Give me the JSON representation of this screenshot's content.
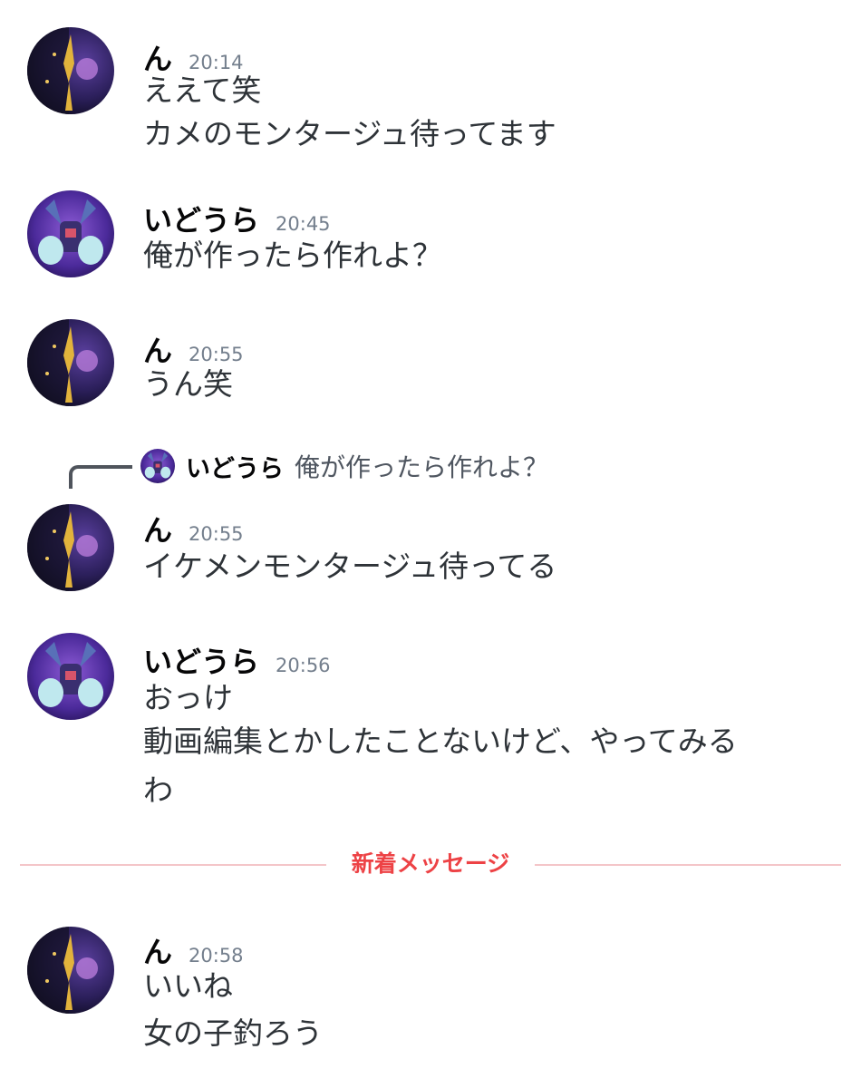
{
  "colors": {
    "text": "#2e3338",
    "author": "#060607",
    "timestamp": "#747f8d",
    "new_divider": "#ed4245",
    "reply_line": "#4f545c"
  },
  "users": {
    "n": {
      "name": "ん",
      "avatar_icon": "moon-split-avatar-icon"
    },
    "idoura": {
      "name": "いどうら",
      "avatar_icon": "purple-creature-avatar-icon"
    }
  },
  "messages": [
    {
      "author": "ん",
      "time": "20:14",
      "lines": [
        "ええて笑",
        "カメのモンタージュ待ってます"
      ]
    },
    {
      "author": "いどうら",
      "time": "20:45",
      "lines": [
        "俺が作ったら作れよ？"
      ]
    },
    {
      "author": "ん",
      "time": "20:55",
      "lines": [
        "うん笑"
      ]
    },
    {
      "author": "ん",
      "time": "20:55",
      "lines": [
        "イケメンモンタージュ待ってる"
      ],
      "reply": {
        "author": "いどうら",
        "text": "俺が作ったら作れよ？"
      }
    },
    {
      "author": "いどうら",
      "time": "20:56",
      "lines": [
        "おっけ",
        "動画編集とかしたことないけど、やってみる",
        "わ"
      ]
    },
    {
      "author": "ん",
      "time": "20:58",
      "lines": [
        "いいね",
        "女の子釣ろう"
      ]
    }
  ],
  "divider": {
    "label": "新着メッセージ"
  }
}
